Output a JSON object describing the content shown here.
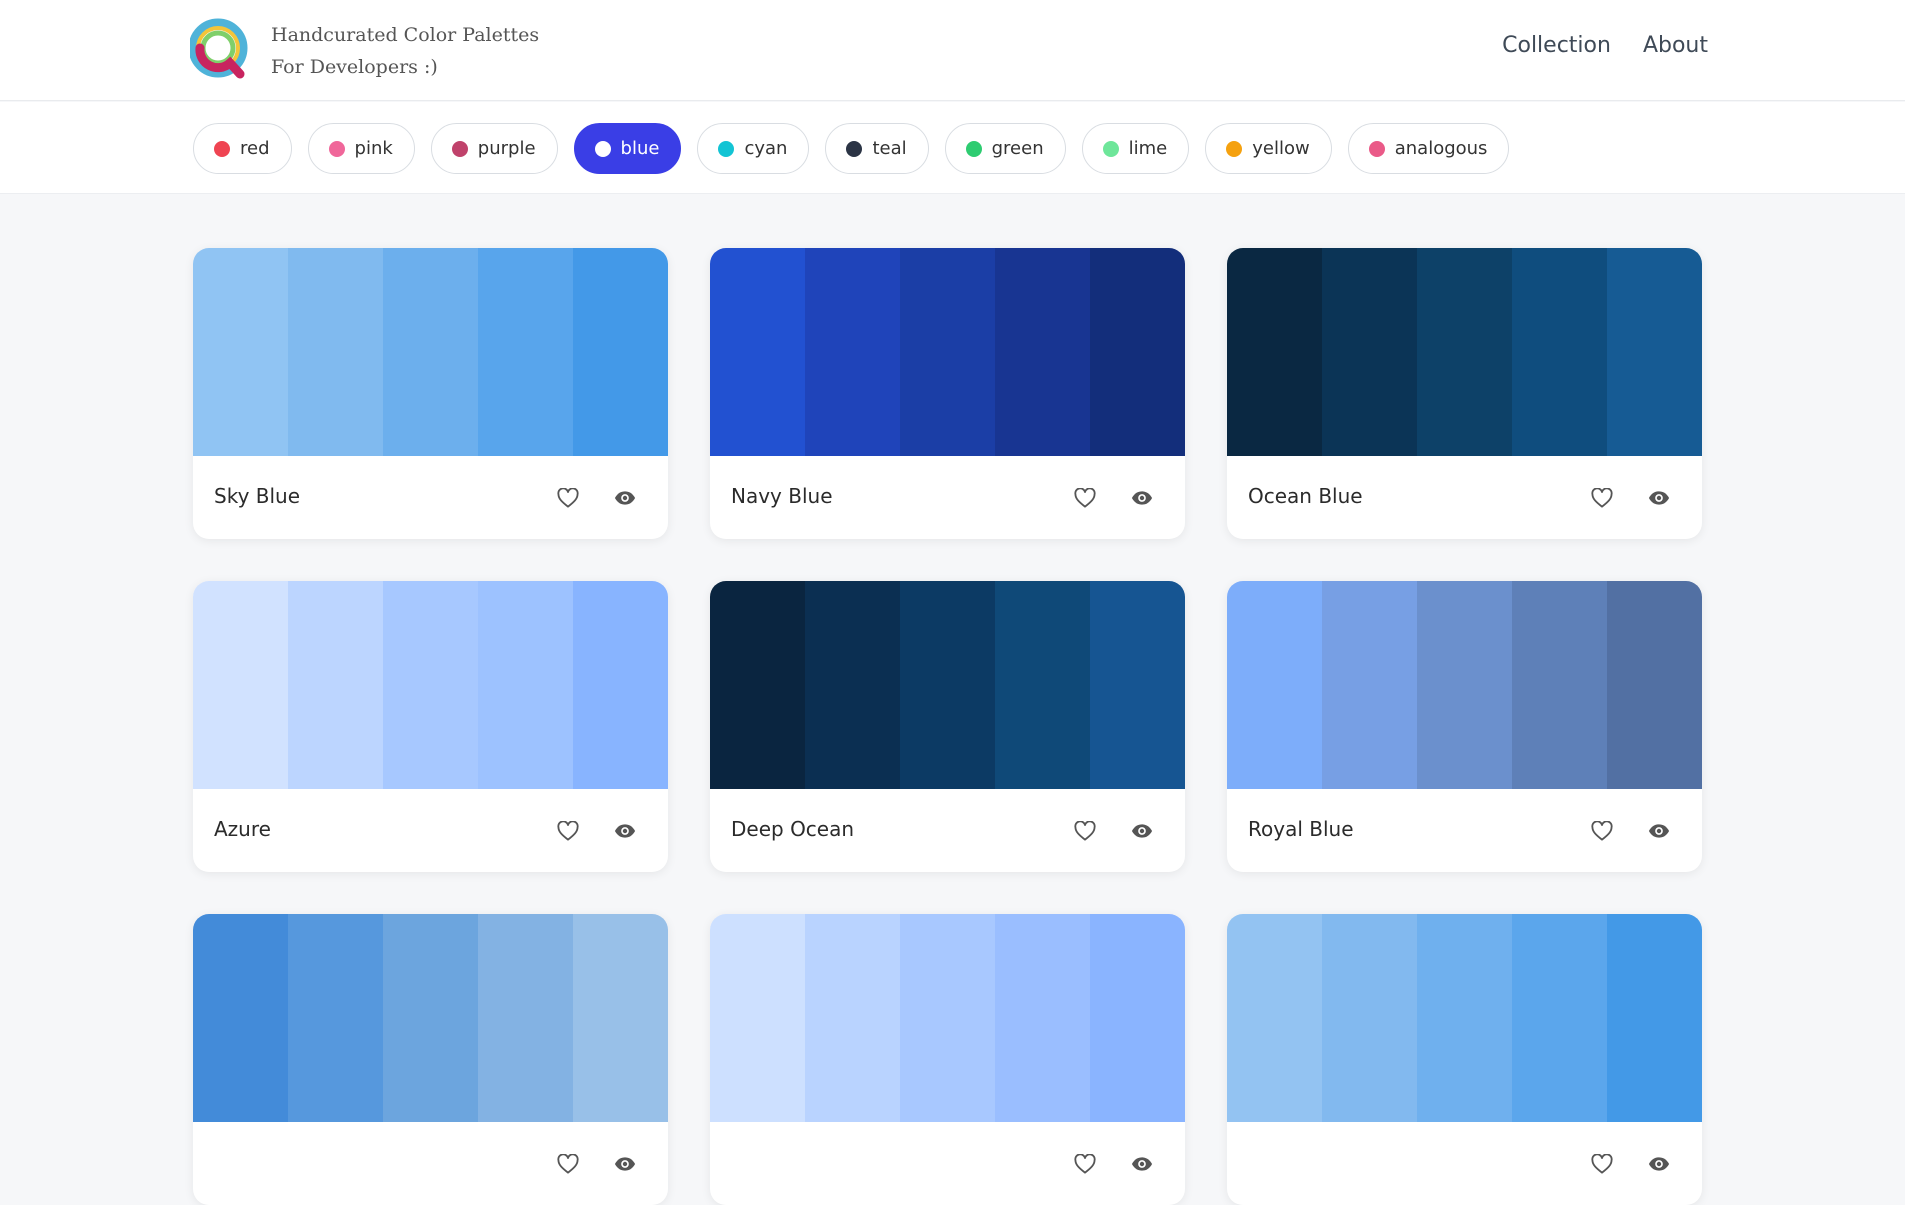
{
  "header": {
    "tagline_line1": "Handcurated Color Palettes",
    "tagline_line2": "For Developers :)",
    "nav": [
      "Collection",
      "About"
    ]
  },
  "filters": [
    {
      "label": "red",
      "color": "#ef4452",
      "active": false
    },
    {
      "label": "pink",
      "color": "#f0679a",
      "active": false
    },
    {
      "label": "purple",
      "color": "#c0426b",
      "active": false
    },
    {
      "label": "blue",
      "color": "#ffffff",
      "active": true
    },
    {
      "label": "cyan",
      "color": "#13c4d4",
      "active": false
    },
    {
      "label": "teal",
      "color": "#2b3445",
      "active": false
    },
    {
      "label": "green",
      "color": "#2ecc71",
      "active": false
    },
    {
      "label": "lime",
      "color": "#6ee69a",
      "active": false
    },
    {
      "label": "yellow",
      "color": "#f5a10f",
      "active": false
    },
    {
      "label": "analogous",
      "color": "#ea5a88",
      "active": false
    }
  ],
  "palettes": [
    {
      "name": "Sky Blue",
      "colors": [
        "#90c4f3",
        "#80baef",
        "#6cafed",
        "#58a5ec",
        "#4399e8"
      ]
    },
    {
      "name": "Navy Blue",
      "colors": [
        "#2251d1",
        "#1f44ba",
        "#1b3ea6",
        "#183592",
        "#132e7b"
      ]
    },
    {
      "name": "Ocean Blue",
      "colors": [
        "#0a2842",
        "#0b3456",
        "#0d4168",
        "#0f4d7e",
        "#165b94"
      ]
    },
    {
      "name": "Azure",
      "colors": [
        "#d1e2ff",
        "#bcd5ff",
        "#a7c8ff",
        "#9dc2ff",
        "#88b4ff"
      ]
    },
    {
      "name": "Deep Ocean",
      "colors": [
        "#0a2540",
        "#0b2f52",
        "#0c3a64",
        "#0f4978",
        "#165592"
      ]
    },
    {
      "name": "Royal Blue",
      "colors": [
        "#7dadfa",
        "#779fe4",
        "#6b90cd",
        "#5e80b8",
        "#5270a3"
      ]
    },
    {
      "name": "",
      "colors": [
        "#438bd9",
        "#5698dd",
        "#6ca5de",
        "#83b2e3",
        "#98c0e8"
      ]
    },
    {
      "name": "",
      "colors": [
        "#cde0ff",
        "#b9d3ff",
        "#a8c8ff",
        "#9abeff",
        "#8ab4ff"
      ]
    },
    {
      "name": "",
      "colors": [
        "#93c3f2",
        "#82b9ef",
        "#6fb0ee",
        "#5ba6ec",
        "#4399e7"
      ]
    }
  ]
}
